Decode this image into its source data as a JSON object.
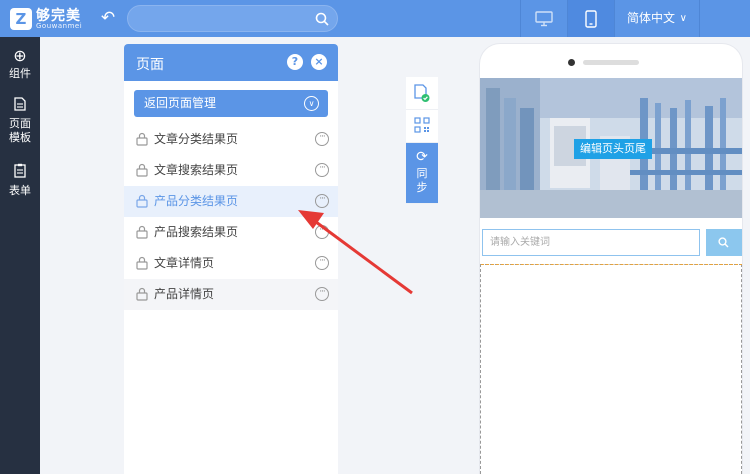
{
  "topbar": {
    "logo_mark": "Z",
    "logo_title": "够完美",
    "logo_subtitle": "Gouwanmei",
    "search_placeholder": "",
    "language": "简体中文"
  },
  "sidebar": {
    "items": [
      {
        "label": "组件",
        "icon": "plus-circle-icon"
      },
      {
        "label": "页面",
        "label2": "模板",
        "icon": "page-icon"
      },
      {
        "label": "表单",
        "icon": "clipboard-icon"
      }
    ]
  },
  "panel": {
    "title": "页面",
    "help": "?",
    "close": "×",
    "back_label": "返回页面管理",
    "pages": [
      {
        "name": "文章分类结果页"
      },
      {
        "name": "文章搜索结果页"
      },
      {
        "name": "产品分类结果页"
      },
      {
        "name": "产品搜索结果页"
      },
      {
        "name": "文章详情页"
      },
      {
        "name": "产品详情页"
      }
    ],
    "more_glyph": "···"
  },
  "tools": {
    "sync_label_1": "同",
    "sync_label_2": "步"
  },
  "phone": {
    "banner_edit_label": "编辑页头页尾",
    "search_placeholder": "请输入关键词"
  },
  "colors": {
    "brand": "#5b95e6",
    "sidebar": "#263041",
    "edit_badge": "#1fa1e6",
    "arrow": "#e53935"
  }
}
